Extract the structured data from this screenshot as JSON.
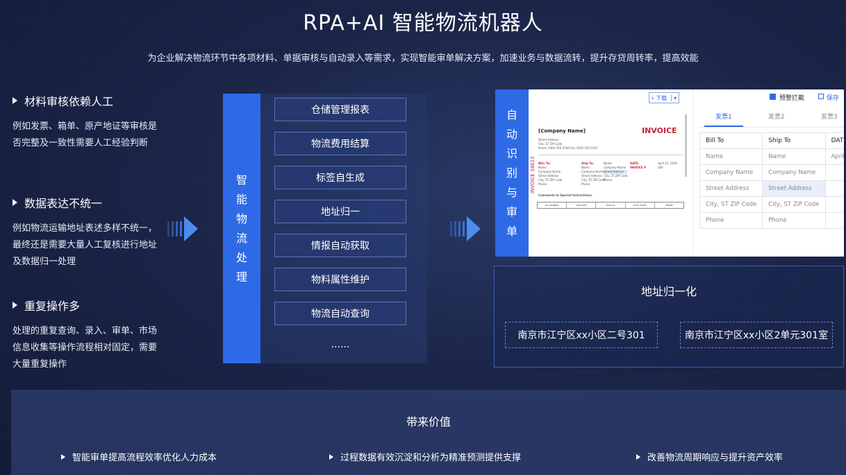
{
  "title": "RPA+AI 智能物流机器人",
  "subtitle": "为企业解决物流环节中各项材料、单据审核与自动录入等需求，实现智能审单解决方案，加速业务与数据流转，提升存贷周转率，提高效能",
  "issues": [
    {
      "heading": "材料审核依赖人工",
      "desc": "例如发票、箱单、原产地证等审核是否完整及一致性需要人工经验判断"
    },
    {
      "heading": "数据表达不统一",
      "desc": "例如物流运输地址表述多样不统一，最终还是需要大量人工复核进行地址及数据归一处理"
    },
    {
      "heading": "重复操作多",
      "desc": "处理的重复查询、录入、审单、市场信息收集等操作流程相对固定，需要大量重复操作"
    }
  ],
  "processing": {
    "label_chars": [
      "智",
      "能",
      "物",
      "流",
      "处",
      "理"
    ],
    "items": [
      "仓储管理报表",
      "物流费用结算",
      "标签自生成",
      "地址归一",
      "情报自动获取",
      "物料属性维护",
      "物流自动查询"
    ],
    "more": "......"
  },
  "recognition": {
    "label_chars": [
      "自",
      "动",
      "识",
      "别",
      "与",
      "审",
      "单"
    ],
    "download_label": "下载",
    "invoice": {
      "vertical": "INVOICE 34623",
      "company": "[Company Name]",
      "word": "INVOICE",
      "address_lines": [
        "Street Address",
        "City, ST ZIP Code",
        "Phone (509) 555-0190   Fax (509) 555-0101"
      ],
      "bill_to": [
        "BILL To:",
        "Name",
        "Company Name",
        "Street Address",
        "City, ST ZIP Code",
        "Phone"
      ],
      "ship_to": [
        "Ship To:",
        "Name",
        "Company Name",
        "Street Address",
        "City, ST ZIP Code",
        "Phone"
      ],
      "date_block": [
        "DATE:",
        "INVOICE #",
        "April 15, 2016",
        "100"
      ],
      "comments": "Comments or Special Instructions:",
      "table_cols": [
        "P.O. NUMBER",
        "SHIP DATE",
        "SHIP VIA",
        "F.O.B. POINT",
        "TERMS"
      ]
    },
    "form": {
      "warn_label": "预警拦截",
      "save_label": "保存",
      "tabs": [
        "发票1",
        "发票2",
        "发票3"
      ],
      "columns": [
        "Bill To",
        "Ship To",
        "DATE"
      ],
      "rows": [
        [
          "Name",
          "Name",
          "April"
        ],
        [
          "Company Name",
          "Company Name",
          ""
        ],
        [
          "Street Address",
          "Street Address",
          ""
        ],
        [
          "City, ST ZIP Code",
          "City, ST ZIP Code",
          ""
        ],
        [
          "Phone",
          "Phone",
          ""
        ]
      ]
    }
  },
  "address": {
    "title": "地址归一化",
    "a": "南京市江宁区xx小区二号301",
    "b": "南京市江宁区xx小区2单元301室"
  },
  "value": {
    "title": "带来价值",
    "items": [
      "智能审单提高流程效率优化人力成本",
      "过程数据有效沉淀和分析为精准预测提供支撑",
      "改善物流周期响应与提升资产效率"
    ]
  }
}
